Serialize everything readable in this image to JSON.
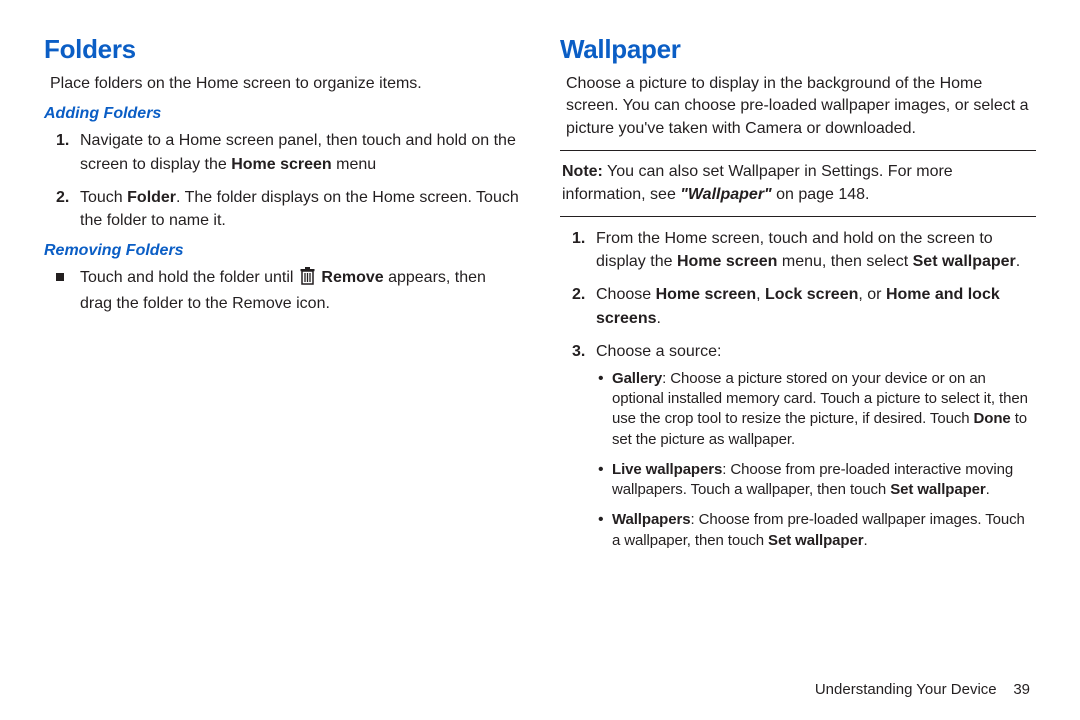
{
  "left": {
    "h1": "Folders",
    "intro": "Place folders on the Home screen to organize items.",
    "sub1": "Adding Folders",
    "add": {
      "n1": "1.",
      "t1a": "Navigate to a Home screen panel, then touch and hold on the screen to display the ",
      "t1b": "Home screen",
      "t1c": " menu",
      "n2": "2.",
      "t2a": "Touch ",
      "t2b": "Folder",
      "t2c": ". The folder displays on the Home screen. Touch the folder to name it."
    },
    "sub2": "Removing Folders",
    "rem": {
      "t1a": "Touch and hold the folder until ",
      "t1b": " Remove",
      "t1c": " appears, then drag the folder to the Remove icon."
    }
  },
  "right": {
    "h1": "Wallpaper",
    "intro": "Choose a picture to display in the background of the Home screen. You can choose pre-loaded wallpaper images, or select a picture you've taken with Camera or downloaded.",
    "note_label": "Note:",
    "note_a": " You can also set Wallpaper in Settings. For more information, see ",
    "note_b": "\"Wallpaper\"",
    "note_c": " on page 148.",
    "steps": {
      "n1": "1.",
      "t1a": "From the Home screen, touch and hold on the screen to display the ",
      "t1b": "Home screen",
      "t1c": " menu, then select ",
      "t1d": "Set wallpaper",
      "t1e": ".",
      "n2": "2.",
      "t2a": "Choose ",
      "t2b": "Home screen",
      "t2c": ", ",
      "t2d": "Lock screen",
      "t2e": ", or ",
      "t2f": "Home and lock screens",
      "t2g": ".",
      "n3": "3.",
      "t3": "Choose a source:"
    },
    "sources": {
      "g_label": "Gallery",
      "g_text": ": Choose a picture stored on your device or on an optional installed memory card. Touch a picture to select it, then use the crop tool to resize the picture, if desired. Touch ",
      "g_done": "Done",
      "g_after": " to set the picture as wallpaper.",
      "lw_label": "Live wallpapers",
      "lw_text": ": Choose from pre-loaded interactive moving wallpapers. Touch a wallpaper, then touch ",
      "lw_set": "Set wallpaper",
      "lw_after": ".",
      "w_label": "Wallpapers",
      "w_text": ": Choose from pre-loaded wallpaper images. Touch a wallpaper, then touch ",
      "w_set": "Set wallpaper",
      "w_after": "."
    }
  },
  "footer": {
    "section": "Understanding Your Device",
    "page": "39"
  }
}
